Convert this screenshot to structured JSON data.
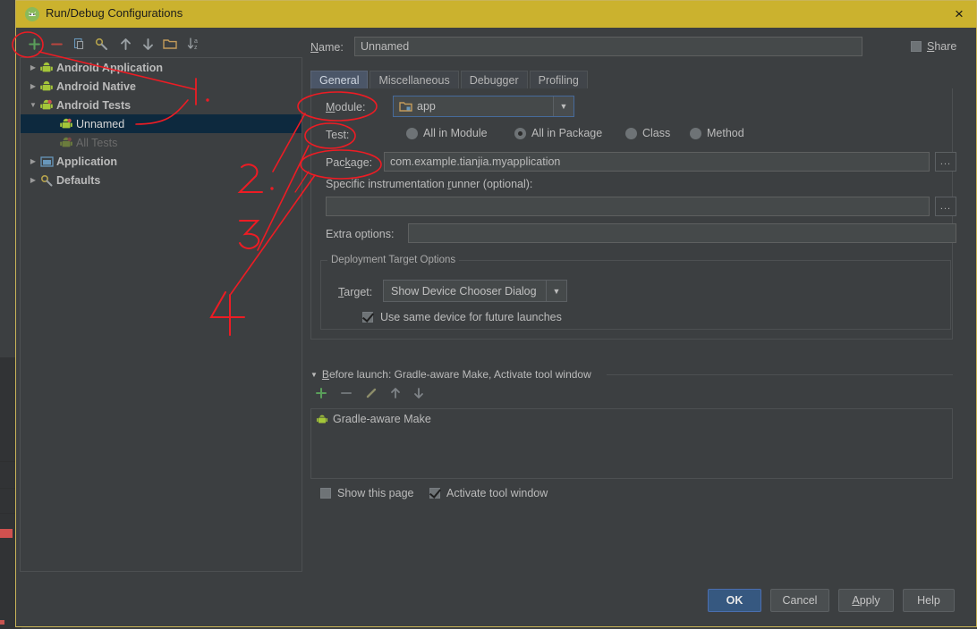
{
  "window": {
    "title": "Run/Debug Configurations",
    "icon": "android-studio-icon",
    "close": "×"
  },
  "toolbar": {
    "items": [
      {
        "name": "add-icon",
        "glyph": "+",
        "color": "#5a9e5a"
      },
      {
        "name": "remove-icon",
        "glyph": "−",
        "color": "#b8453f"
      },
      {
        "name": "copy-icon",
        "glyph": "copy",
        "color": "#6897bb"
      },
      {
        "name": "edit-defaults-icon",
        "glyph": "wrench",
        "color": "#b5a24c"
      },
      {
        "name": "move-up-icon",
        "glyph": "↑",
        "color": "#9aa0a4"
      },
      {
        "name": "move-down-icon",
        "glyph": "↓",
        "color": "#9aa0a4"
      },
      {
        "name": "folder-icon",
        "glyph": "folder",
        "color": "#c39b5a"
      },
      {
        "name": "sort-alphabetically-icon",
        "glyph": "↓az",
        "color": "#9aa0a4"
      }
    ]
  },
  "tree": {
    "nodes": [
      {
        "label": "Android Application",
        "indent": 0,
        "arrow": "▶",
        "icon": "android-icon",
        "bold": true,
        "selected": false,
        "dim": false
      },
      {
        "label": "Android Native",
        "indent": 0,
        "arrow": "▶",
        "icon": "android-icon",
        "bold": true,
        "selected": false,
        "dim": false
      },
      {
        "label": "Android Tests",
        "indent": 0,
        "arrow": "▼",
        "icon": "android-test-icon",
        "bold": true,
        "selected": false,
        "dim": false
      },
      {
        "label": "Unnamed",
        "indent": 1,
        "arrow": "",
        "icon": "android-test-icon",
        "bold": false,
        "selected": true,
        "dim": false
      },
      {
        "label": "All Tests",
        "indent": 1,
        "arrow": "",
        "icon": "android-test-icon",
        "bold": false,
        "selected": false,
        "dim": true
      },
      {
        "label": "Application",
        "indent": 0,
        "arrow": "▶",
        "icon": "application-icon",
        "bold": true,
        "selected": false,
        "dim": false
      },
      {
        "label": "Defaults",
        "indent": 0,
        "arrow": "▶",
        "icon": "defaults-icon",
        "bold": true,
        "selected": false,
        "dim": false
      }
    ]
  },
  "form": {
    "name_label": "Name:",
    "name_label_mnemonic": "N",
    "name_value": "Unnamed",
    "share_label": "Share",
    "share_checked": false,
    "tabs": [
      {
        "label": "General",
        "active": true
      },
      {
        "label": "Miscellaneous",
        "active": false
      },
      {
        "label": "Debugger",
        "active": false
      },
      {
        "label": "Profiling",
        "active": false
      }
    ],
    "module_label": "Module:",
    "module_value": "app",
    "module_icon": "module-folder-icon",
    "test_label": "Test:",
    "test_options": [
      {
        "label": "All in Module",
        "selected": false
      },
      {
        "label": "All in Package",
        "selected": true
      },
      {
        "label": "Class",
        "selected": false
      },
      {
        "label": "Method",
        "selected": false
      }
    ],
    "package_label": "Package:",
    "package_value": "com.example.tianjia.myapplication",
    "package_browse": "...",
    "runner_label": "Specific instrumentation runner (optional):",
    "runner_value": "",
    "runner_browse": "...",
    "extra_options_label": "Extra options:",
    "extra_options_value": "",
    "deployment_group_title": "Deployment Target Options",
    "target_label": "Target:",
    "target_value": "Show Device Chooser Dialog",
    "same_device_label": "Use same device for future launches",
    "same_device_checked": true
  },
  "before_launch": {
    "title": "Before launch: Gradle-aware Make, Activate tool window",
    "collapse_arrow": "▼",
    "toolbar": [
      {
        "name": "add-task-icon",
        "glyph": "+",
        "color": "#5a9e5a"
      },
      {
        "name": "remove-task-icon",
        "glyph": "−",
        "color": "#6e7376"
      },
      {
        "name": "edit-task-icon",
        "glyph": "pencil",
        "color": "#8d8d6a"
      },
      {
        "name": "move-task-up-icon",
        "glyph": "↑",
        "color": "#7e8387"
      },
      {
        "name": "move-task-down-icon",
        "glyph": "↓",
        "color": "#7e8387"
      }
    ],
    "items": [
      {
        "label": "Gradle-aware Make",
        "icon": "gradle-android-icon"
      }
    ],
    "show_page_label": "Show this page",
    "show_page_checked": false,
    "activate_tool_window_label": "Activate tool window",
    "activate_tool_window_checked": true
  },
  "buttons": {
    "ok": "OK",
    "cancel": "Cancel",
    "apply": "Apply",
    "help": "Help"
  },
  "annotations": {
    "marks": [
      "1",
      "2",
      "3",
      "4"
    ],
    "color": "#ed1c24",
    "circled": [
      "add-button",
      "Module:",
      "Test:",
      "Package:"
    ]
  },
  "colors": {
    "title_bar": "#cbb22e",
    "dialog_bg": "#3c3f41",
    "selection": "#0d293e",
    "accent_button": "#365880",
    "annotation_red": "#ed1c24",
    "border": "#4d5052"
  }
}
